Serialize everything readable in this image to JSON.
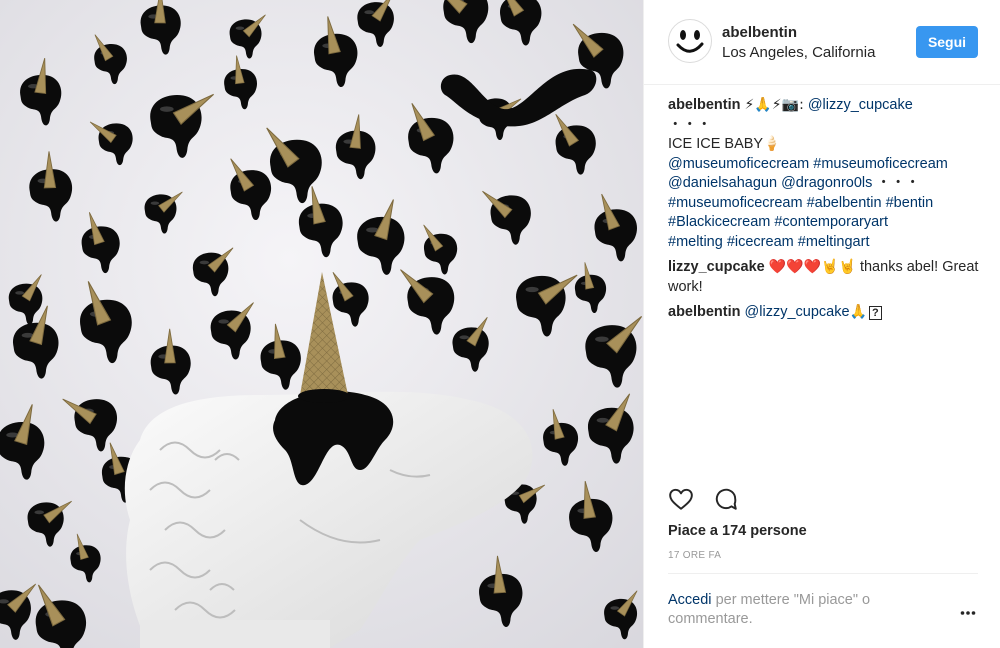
{
  "post": {
    "author": {
      "username": "abelbentin",
      "location": "Los Angeles, California",
      "follow_label": "Segui"
    },
    "caption": {
      "username": "abelbentin",
      "emoji_prefix": "⚡🙏⚡📷:",
      "mention": "@lizzy_cupcake",
      "dots": "・・・",
      "line1": "ICE ICE BABY",
      "line1_emoji": "🍦",
      "tags_a": "@museumoficecream #museumoficecream",
      "tags_b": "@danielsahagun @dragonro0ls",
      "dots2": "・・・",
      "tags_c": "#museumoficecream #abelbentin #bentin",
      "tags_d": "#Blackicecream #contemporaryart",
      "tags_e": "#melting #icecream #meltingart"
    },
    "comments": [
      {
        "username": "lizzy_cupcake",
        "emoji": "❤️❤️❤️🤘🤘",
        "text": "thanks abel! Great work!"
      },
      {
        "username": "abelbentin",
        "mention": "@lizzy_cupcake",
        "emoji": "🙏",
        "tail": "?"
      }
    ],
    "likes_text": "Piace a 174 persone",
    "timestamp": "17 ORE FA",
    "login_link": "Accedi",
    "login_rest": "per mettere \"Mi piace\" o commentare."
  },
  "icons": [
    "heart-icon",
    "comment-icon",
    "more-options-icon",
    "smiley-avatar-icon"
  ],
  "colors": {
    "follow_button": "#3897f0",
    "link": "#003569",
    "muted": "#999999",
    "text": "#262626"
  }
}
